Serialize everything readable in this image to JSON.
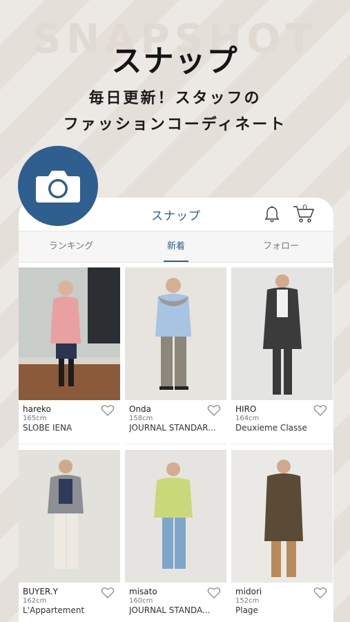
{
  "promo": {
    "watermark": "SNAPSHOT",
    "headline": "スナップ",
    "subline1": "毎日更新！スタッフの",
    "subline2": "ファッションコーディネート"
  },
  "app": {
    "title": "スナップ",
    "cart_count": "0",
    "tabs": [
      {
        "label": "ランキング",
        "active": false
      },
      {
        "label": "新着",
        "active": true
      },
      {
        "label": "フォロー",
        "active": false
      }
    ]
  },
  "snaps": [
    {
      "name": "hareko",
      "height": "165cm",
      "brand": "SLOBE IENA"
    },
    {
      "name": "Onda",
      "height": "158cm",
      "brand": "JOURNAL STANDAR..."
    },
    {
      "name": "HIRO",
      "height": "164cm",
      "brand": "Deuxieme Classe"
    },
    {
      "name": "BUYER.Y",
      "height": "162cm",
      "brand": "L'Appartement"
    },
    {
      "name": "misato",
      "height": "160cm",
      "brand": "JOURNAL STANDA..."
    },
    {
      "name": "midori",
      "height": "152cm",
      "brand": "Plage"
    }
  ],
  "colors": {
    "accent": "#2f5f8e",
    "badge": "#2e5f8e",
    "background": "#ece8e3"
  }
}
